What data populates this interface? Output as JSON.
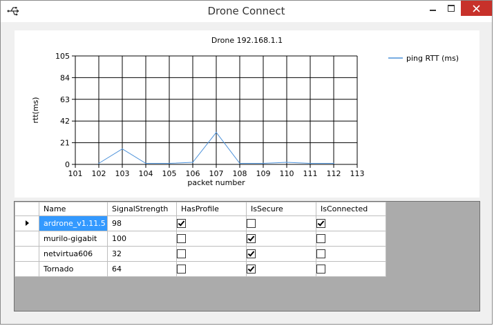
{
  "window": {
    "title": "Drone Connect"
  },
  "chart": {
    "title": "Drone 192.168.1.1"
  },
  "chart_data": {
    "type": "line",
    "title": "Drone 192.168.1.1",
    "xlabel": "packet number",
    "ylabel": "rtt(ms)",
    "xlim": [
      101,
      113
    ],
    "ylim": [
      0,
      105
    ],
    "xticks": [
      101,
      102,
      103,
      104,
      105,
      106,
      107,
      108,
      109,
      110,
      111,
      112,
      113
    ],
    "yticks": [
      0,
      21,
      42,
      63,
      84,
      105
    ],
    "grid": true,
    "legend_position": "top-right",
    "series": [
      {
        "name": "ping RTT (ms)",
        "color": "#4a90d9",
        "x": [
          102,
          103,
          104,
          105,
          106,
          107,
          108,
          109,
          110,
          111,
          112
        ],
        "y": [
          1,
          15,
          1,
          1,
          2,
          31,
          1,
          1,
          2,
          1,
          1
        ]
      }
    ]
  },
  "table": {
    "columns": [
      "Name",
      "SignalStrength",
      "HasProfile",
      "IsSecure",
      "IsConnected"
    ],
    "rows": [
      {
        "name": "ardrone_v1.11.5",
        "signal": "98",
        "has_profile": true,
        "is_secure": false,
        "is_connected": true
      },
      {
        "name": "murilo-gigabit",
        "signal": "100",
        "has_profile": false,
        "is_secure": true,
        "is_connected": false
      },
      {
        "name": "netvirtua606",
        "signal": "32",
        "has_profile": false,
        "is_secure": true,
        "is_connected": false
      },
      {
        "name": "Tornado",
        "signal": "64",
        "has_profile": false,
        "is_secure": true,
        "is_connected": false
      }
    ]
  }
}
